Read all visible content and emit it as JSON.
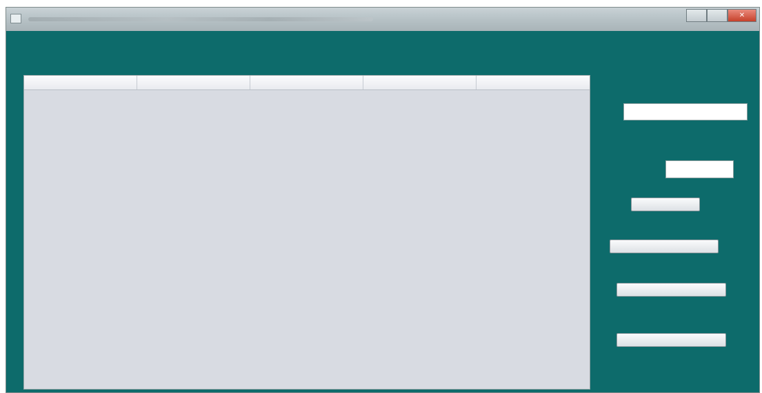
{
  "window": {
    "title": "",
    "controls": {
      "minimize": "",
      "maximize": "",
      "close": "✕"
    }
  },
  "table": {
    "columns": [
      "",
      "",
      "",
      "",
      ""
    ],
    "rows": []
  },
  "summary": {
    "heading": "",
    "rs_label": "",
    "rs_value": "",
    "discount_text": "",
    "cash_label": "",
    "cash_value": ""
  },
  "actions": {
    "button_1": "",
    "button_2": "",
    "button_3": "",
    "button_4": ""
  },
  "colors": {
    "window_background": "#0d6b6b",
    "table_background": "#d8dbe2",
    "heading_text": "#cfe5e5"
  },
  "icons": {
    "app": "app-icon",
    "close": "close-icon"
  }
}
